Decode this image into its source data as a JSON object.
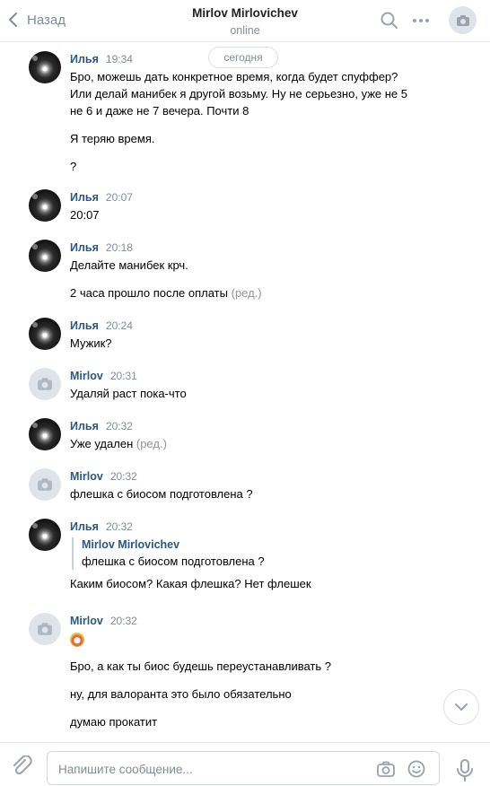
{
  "header": {
    "back_label": "Назад",
    "title": "Mirlov Mirlovichev",
    "status": "online",
    "icons": [
      "chevron-left-icon",
      "search-icon",
      "more-icon",
      "camera-icon"
    ]
  },
  "date_separator": "сегодня",
  "messages": [
    {
      "author": "Илья",
      "time": "19:34",
      "avatar": "photo",
      "lines": [
        "Бро, можешь дать конкретное время, когда будет спуффер?",
        "Или делай манибек я другой возьму. Ну не серьезно, уже не 5",
        "не 6 и даже не 7 вечера. Почти 8",
        "Я теряю время.",
        "?"
      ]
    },
    {
      "author": "Илья",
      "time": "20:07",
      "avatar": "photo",
      "lines": [
        "20:07"
      ]
    },
    {
      "author": "Илья",
      "time": "20:18",
      "avatar": "photo",
      "lines": [
        "Делайте манибек крч.",
        "2 часа прошло после оплаты"
      ],
      "edited": "(ред.)"
    },
    {
      "author": "Илья",
      "time": "20:24",
      "avatar": "photo",
      "lines": [
        "Мужик?"
      ]
    },
    {
      "author": "Mirlov",
      "time": "20:31",
      "avatar": "camera",
      "lines": [
        "Удаляй раст пока-что"
      ]
    },
    {
      "author": "Илья",
      "time": "20:32",
      "avatar": "photo",
      "lines": [
        "Уже удален"
      ],
      "edited": "(ред.)"
    },
    {
      "author": "Mirlov",
      "time": "20:32",
      "avatar": "camera",
      "lines": [
        "флешка с биосом подготовлена ?"
      ]
    },
    {
      "author": "Илья",
      "time": "20:32",
      "avatar": "photo",
      "quote": {
        "author": "Mirlov Mirlovichev",
        "text": "флешка с биосом подготовлена ?"
      },
      "lines": [
        "Каким биосом? Какая флешка? Нет флешек"
      ]
    },
    {
      "author": "Mirlov",
      "time": "20:32",
      "avatar": "camera",
      "emoji": "clown-emoji",
      "lines": [
        "Бро, а как ты биос будешь переустанавливать ?",
        "ну, для валоранта это было обязательно",
        "думаю прокатит"
      ]
    }
  ],
  "composer": {
    "placeholder": "Напишите сообщение...",
    "icons": [
      "paperclip-icon",
      "camera-icon",
      "smile-icon",
      "microphone-icon"
    ]
  },
  "colors": {
    "link": "#2a5885",
    "muted": "#818c99",
    "avatar_placeholder": "#dfe4ea",
    "border": "#e7e8ec"
  }
}
